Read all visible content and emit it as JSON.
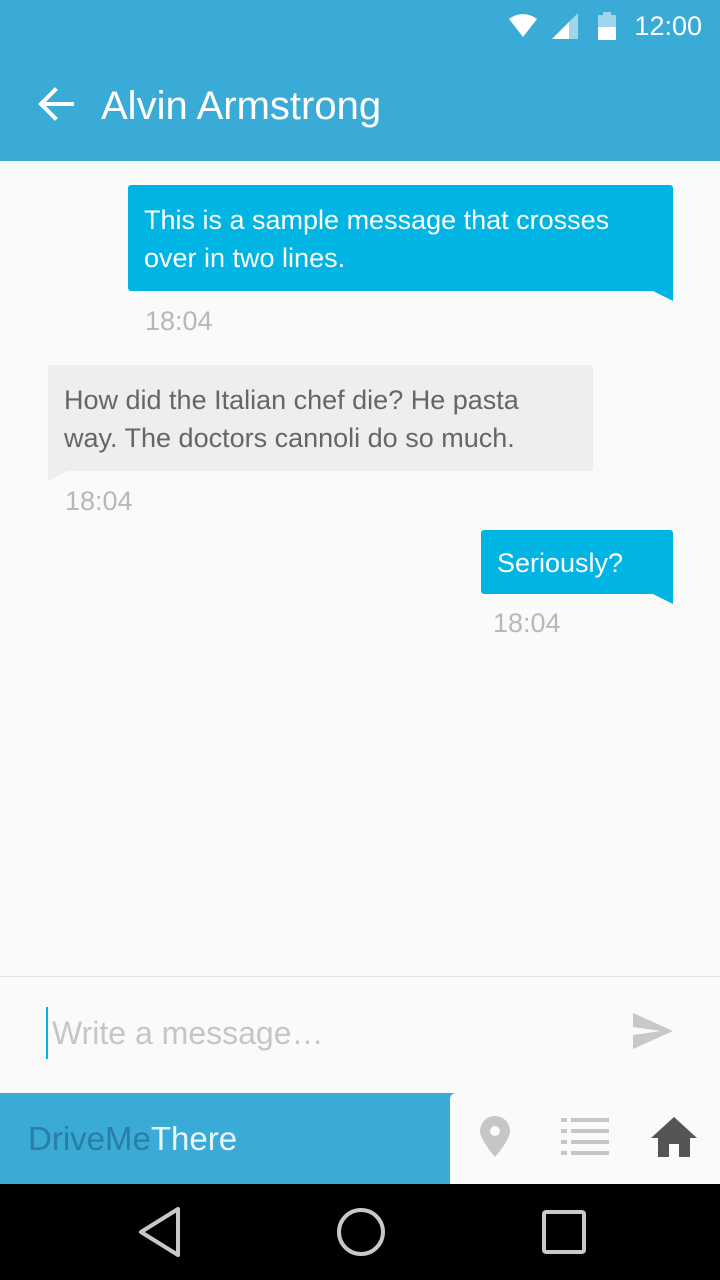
{
  "status_bar": {
    "time": "12:00",
    "icons": [
      "wifi-icon",
      "cell-signal-icon",
      "battery-icon"
    ]
  },
  "app_bar": {
    "back_icon": "arrow-back-icon",
    "title": "Alvin Armstrong"
  },
  "messages": [
    {
      "direction": "sent",
      "text": "This is a sample message that crosses over in two lines.",
      "time": "18:04"
    },
    {
      "direction": "received",
      "text": "How did the Italian chef die? He pasta way. The doctors cannoli do so much.",
      "time": "18:04"
    },
    {
      "direction": "sent",
      "text": "Seriously?",
      "time": "18:04"
    }
  ],
  "composer": {
    "placeholder": "Write a message…",
    "value": "",
    "send_icon": "send-icon"
  },
  "bottom_bar": {
    "brand_part1": "DriveMe",
    "brand_part2": "There",
    "nav_icons": [
      "map-pin-icon",
      "list-icon",
      "home-icon"
    ]
  },
  "system_nav": {
    "icons": [
      "back-triangle-icon",
      "home-circle-icon",
      "recents-square-icon"
    ]
  },
  "colors": {
    "primary": "#3aabd7",
    "sent_bubble": "#00b4e4",
    "received_bubble": "#eeeeee",
    "timestamp": "#b8b8b8",
    "brand_dark": "#2a7ea6"
  }
}
